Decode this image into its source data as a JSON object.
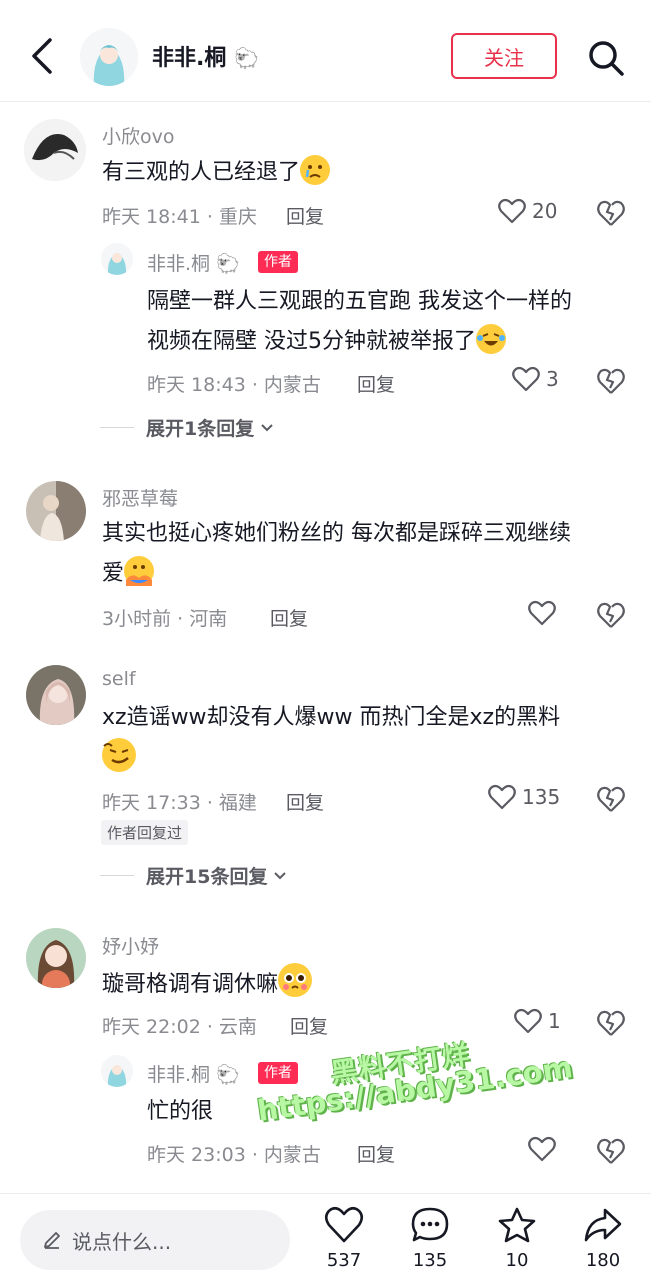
{
  "header": {
    "name": "非非.桐",
    "follow_label": "关注"
  },
  "comments": [
    {
      "username": "小欣ovo",
      "text": "有三观的人已经退了",
      "emoji": "crying-face",
      "meta": "昨天 18:41 · 重庆",
      "reply_label": "回复",
      "likes": "20",
      "replies": [
        {
          "username": "非非.桐",
          "author_tag": "作者",
          "text_line1": "隔壁一群人三观跟的五官跑 我发这个一样的",
          "text_line2": "视频在隔壁 没过5分钟就被举报了",
          "emoji": "laughing-crying-face",
          "meta": "昨天 18:43 · 内蒙古",
          "reply_label": "回复",
          "likes": "3"
        }
      ],
      "expand_label": "展开1条回复"
    },
    {
      "username": "邪恶草莓",
      "text_line1": "其实也挺心疼她们粉丝的 每次都是踩碎三观继续",
      "text_line2": "爱",
      "emoji": "hugging-face",
      "meta": "3小时前 · 河南",
      "reply_label": "回复",
      "likes": ""
    },
    {
      "username": "self",
      "text_line1": "xz造谣ww却没有人爆ww 而热门全是xz的黑料",
      "emoji": "smirk-face",
      "meta": "昨天 17:33 · 福建",
      "reply_label": "回复",
      "likes": "135",
      "author_replied_tag": "作者回复过",
      "expand_label": "展开15条回复"
    },
    {
      "username": "妤小妤",
      "text": "璇哥格调有调休嘛",
      "emoji": "pleading-face",
      "meta": "昨天 22:02 · 云南",
      "reply_label": "回复",
      "likes": "1",
      "replies": [
        {
          "username": "非非.桐",
          "author_tag": "作者",
          "text": "忙的很",
          "meta": "昨天 23:03 · 内蒙古",
          "reply_label": "回复",
          "likes": ""
        }
      ]
    }
  ],
  "watermark": {
    "line1": "黑料不打烊",
    "line2": "https://abdy31.com"
  },
  "bottom_bar": {
    "input_placeholder": "说点什么...",
    "likes": "537",
    "comments": "135",
    "favorites": "10",
    "shares": "180"
  },
  "colors": {
    "accent": "#fe2c55",
    "follow_border": "#e8324d",
    "meta_text": "#8a8b91"
  }
}
